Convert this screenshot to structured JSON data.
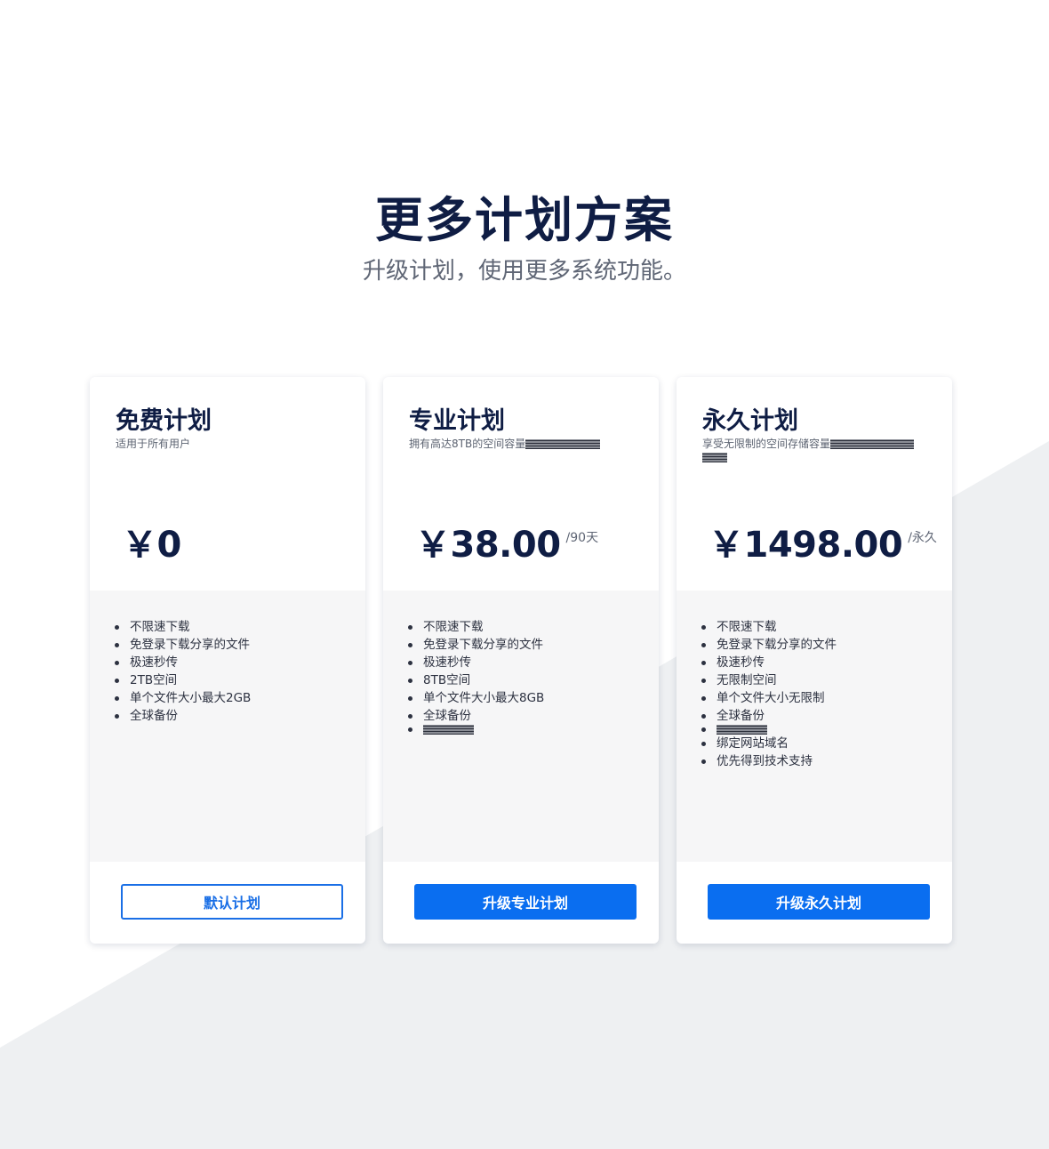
{
  "header": {
    "title": "更多计划方案",
    "subtitle": "升级计划，使用更多系统功能。"
  },
  "colors": {
    "title": "#0f1d44",
    "accent": "#0a6ef0",
    "feature_bg": "#f6f6f7",
    "background_shape": "#eef0f2"
  },
  "plans": [
    {
      "name": "免费计划",
      "description": "适用于所有用户",
      "price": "￥0",
      "period": "",
      "features": [
        "不限速下载",
        "免登录下载分享的文件",
        "极速秒传",
        "2TB空间",
        "单个文件大小最大2GB",
        "全球备份"
      ],
      "button": "默认计划"
    },
    {
      "name": "专业计划",
      "description": "拥有高达8TB的空间容量",
      "price": "￥38.00",
      "period": "/90天",
      "features": [
        "不限速下载",
        "免登录下载分享的文件",
        "极速秒传",
        "8TB空间",
        "单个文件大小最大8GB",
        "全球备份"
      ],
      "button": "升级专业计划"
    },
    {
      "name": "永久计划",
      "description": "享受无限制的空间存储容量",
      "price": "￥1498.00",
      "period": "/永久",
      "features_before": [
        "不限速下载",
        "免登录下载分享的文件",
        "极速秒传",
        "无限制空间",
        "单个文件大小无限制",
        "全球备份"
      ],
      "features_after": [
        "绑定网站域名",
        "优先得到技术支持"
      ],
      "button": "升级永久计划"
    }
  ]
}
